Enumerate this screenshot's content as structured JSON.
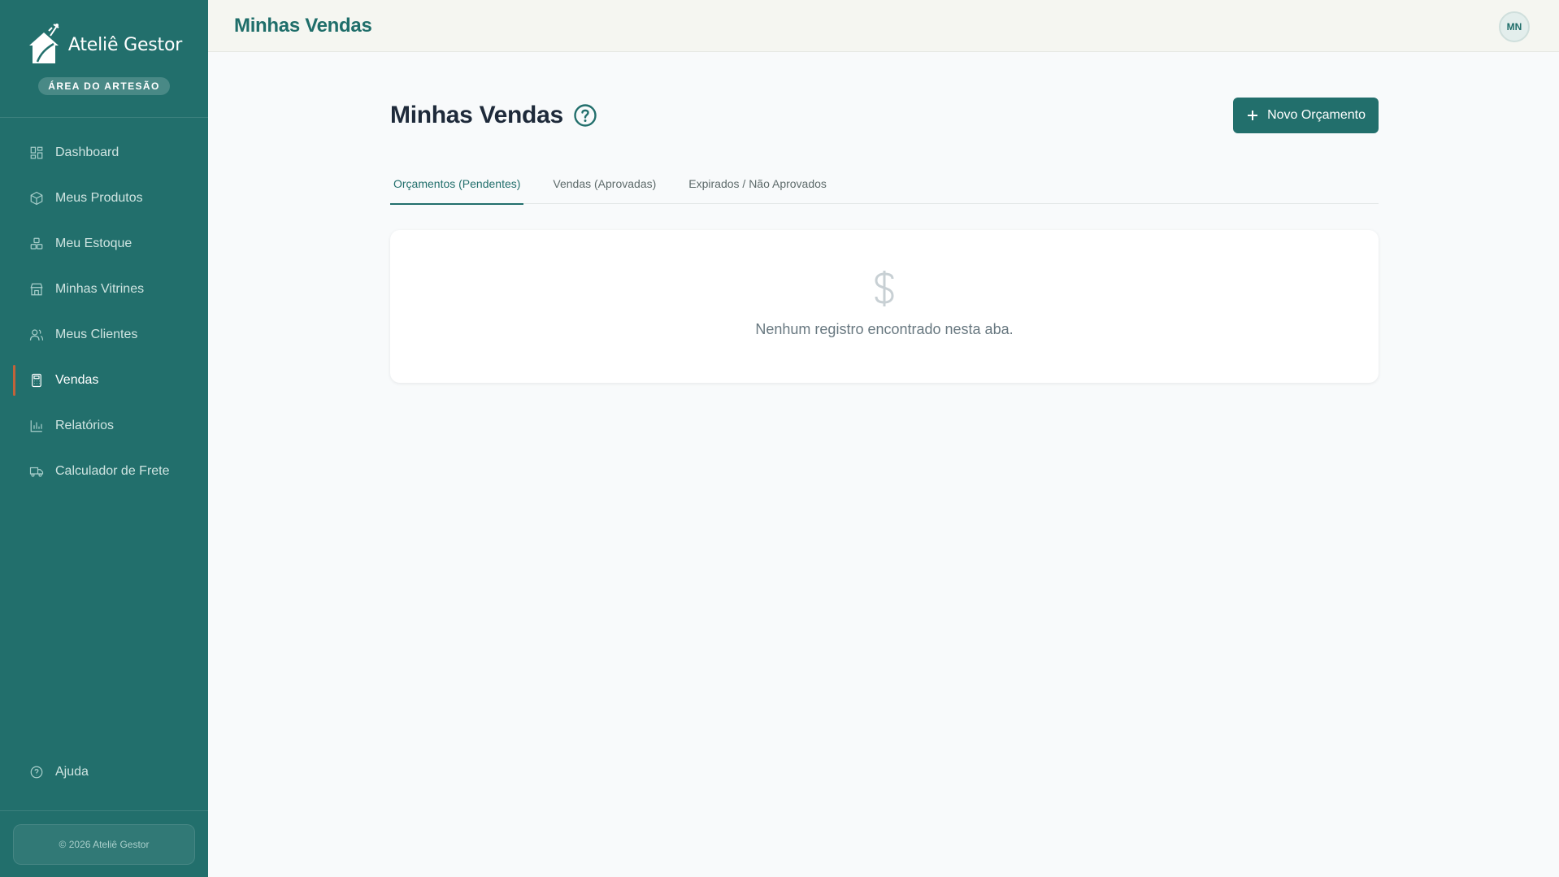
{
  "sidebar": {
    "brand_name": "Ateliê Gestor",
    "badge": "ÁREA DO ARTESÃO",
    "items": [
      {
        "label": "Dashboard",
        "icon": "dashboard-icon"
      },
      {
        "label": "Meus Produtos",
        "icon": "package-icon"
      },
      {
        "label": "Meu Estoque",
        "icon": "boxes-icon"
      },
      {
        "label": "Minhas Vitrines",
        "icon": "store-icon"
      },
      {
        "label": "Meus Clientes",
        "icon": "users-icon"
      },
      {
        "label": "Vendas",
        "icon": "calculator-icon",
        "active": true
      },
      {
        "label": "Relatórios",
        "icon": "bar-chart-icon"
      },
      {
        "label": "Calculador de Frete",
        "icon": "truck-icon"
      }
    ],
    "help_label": "Ajuda",
    "footer": "© 2026 Ateliê Gestor"
  },
  "header": {
    "title": "Minhas Vendas",
    "avatar_initials": "MN"
  },
  "main": {
    "title": "Minhas Vendas",
    "new_button_label": "Novo Orçamento",
    "tabs": [
      {
        "label": "Orçamentos (Pendentes)",
        "active": true
      },
      {
        "label": "Vendas (Aprovadas)",
        "active": false
      },
      {
        "label": "Expirados / Não Aprovados",
        "active": false
      }
    ],
    "empty_message": "Nenhum registro encontrado nesta aba."
  },
  "colors": {
    "sidebar_bg": "#226f6c",
    "accent": "#226f6c",
    "active_marker": "#c2633a",
    "page_bg": "#f8fafb"
  }
}
